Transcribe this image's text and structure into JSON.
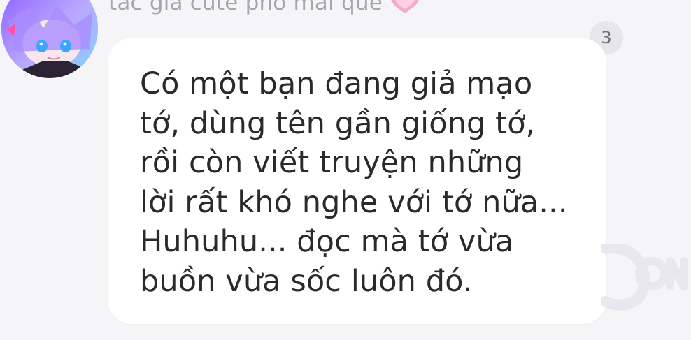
{
  "comment": {
    "author_name": "tác giả cute phô mai que",
    "author_heart_icon": "pink-heart-icon",
    "reply_count": "3",
    "message": "Có một bạn đang giả mạo\ntớ, dùng tên gần giống tớ,\nrồi còn viết truyện những\nlời rất khó nghe với tớ nữa...\nHuhuhu... đọc mà tớ vừa\nbuồn vừa sốc luôn đó."
  },
  "colors": {
    "background": "#f5f5f7",
    "bubble": "#ffffff",
    "text": "#2a2a2a",
    "author": "#a7a7aa",
    "badge_bg": "#e7e7ea",
    "heart": "#f7a9c9"
  }
}
